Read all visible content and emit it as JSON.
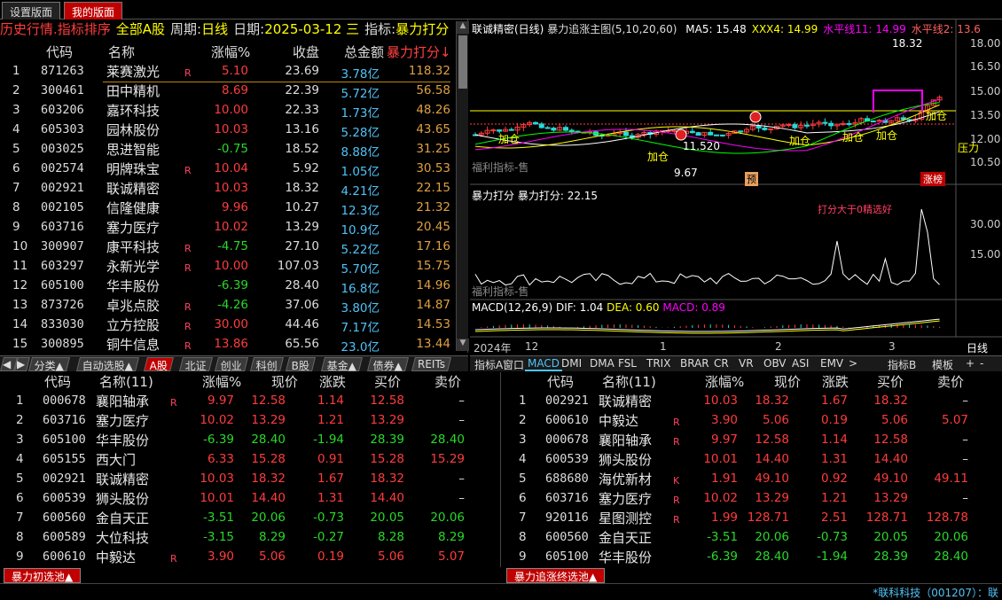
{
  "top_tabs": [
    "设置版面",
    "我的版面"
  ],
  "header": {
    "title": "历史行情.指标排序",
    "market": "全部A股",
    "period_label": "周期:",
    "period": "日线",
    "date_label": "日期:",
    "date": "2025-03-12 三",
    "indicator_label": "指标:",
    "indicator": "暴力打分"
  },
  "list_columns": [
    "代码",
    "名称",
    "涨幅%",
    "收盘",
    "总金额",
    "暴力打分↓"
  ],
  "list_rows": [
    {
      "i": "1",
      "code": "871263",
      "name": "莱赛激光",
      "flag": "R",
      "chg": "5.10",
      "price": "23.69",
      "amt": "3.78亿",
      "score": "118.32",
      "dir": "up"
    },
    {
      "i": "2",
      "code": "300461",
      "name": "田中精机",
      "flag": "",
      "chg": "8.69",
      "price": "22.39",
      "amt": "5.72亿",
      "score": "56.58",
      "dir": "up"
    },
    {
      "i": "3",
      "code": "603206",
      "name": "嘉环科技",
      "flag": "",
      "chg": "10.00",
      "price": "22.33",
      "amt": "1.73亿",
      "score": "48.26",
      "dir": "up"
    },
    {
      "i": "4",
      "code": "605303",
      "name": "园林股份",
      "flag": "",
      "chg": "10.03",
      "price": "13.16",
      "amt": "5.28亿",
      "score": "43.65",
      "dir": "up"
    },
    {
      "i": "5",
      "code": "003025",
      "name": "思进智能",
      "flag": "",
      "chg": "-0.75",
      "price": "18.52",
      "amt": "8.88亿",
      "score": "31.25",
      "dir": "down"
    },
    {
      "i": "6",
      "code": "002574",
      "name": "明牌珠宝",
      "flag": "R",
      "chg": "10.04",
      "price": "5.92",
      "amt": "1.05亿",
      "score": "30.53",
      "dir": "up"
    },
    {
      "i": "7",
      "code": "002921",
      "name": "联诚精密",
      "flag": "",
      "chg": "10.03",
      "price": "18.32",
      "amt": "4.21亿",
      "score": "22.15",
      "dir": "up"
    },
    {
      "i": "8",
      "code": "002105",
      "name": "信隆健康",
      "flag": "",
      "chg": "9.96",
      "price": "10.27",
      "amt": "12.3亿",
      "score": "21.32",
      "dir": "up"
    },
    {
      "i": "9",
      "code": "603716",
      "name": "塞力医疗",
      "flag": "",
      "chg": "10.02",
      "price": "13.29",
      "amt": "10.9亿",
      "score": "20.45",
      "dir": "up"
    },
    {
      "i": "10",
      "code": "300907",
      "name": "康平科技",
      "flag": "R",
      "chg": "-4.75",
      "price": "27.10",
      "amt": "5.22亿",
      "score": "17.16",
      "dir": "down"
    },
    {
      "i": "11",
      "code": "603297",
      "name": "永新光学",
      "flag": "R",
      "chg": "10.00",
      "price": "107.03",
      "amt": "5.70亿",
      "score": "15.75",
      "dir": "up"
    },
    {
      "i": "12",
      "code": "605100",
      "name": "华丰股份",
      "flag": "",
      "chg": "-6.39",
      "price": "28.40",
      "amt": "16.8亿",
      "score": "14.96",
      "dir": "down"
    },
    {
      "i": "13",
      "code": "873726",
      "name": "卓兆点胶",
      "flag": "R",
      "chg": "-4.26",
      "price": "37.06",
      "amt": "3.80亿",
      "score": "14.87",
      "dir": "down"
    },
    {
      "i": "14",
      "code": "833030",
      "name": "立方控股",
      "flag": "R",
      "chg": "30.00",
      "price": "44.46",
      "amt": "7.17亿",
      "score": "14.53",
      "dir": "up"
    },
    {
      "i": "15",
      "code": "300895",
      "name": "铜牛信息",
      "flag": "R",
      "chg": "13.86",
      "price": "65.56",
      "amt": "23.0亿",
      "score": "13.44",
      "dir": "up"
    }
  ],
  "category_tabs": [
    "分类▲",
    "自动选股▲",
    "A股",
    "北证",
    "创业",
    "科创",
    "B股",
    "基金▲",
    "债券▲",
    "REITs"
  ],
  "chart": {
    "main_title": "联诚精密(日线)",
    "main_indicator": "暴力追涨主图(5,10,20,60)",
    "ma_labels": [
      {
        "t": "MA5: 15.48",
        "c": "#ffffff"
      },
      {
        "t": "XXX4: 14.99",
        "c": "#ffff00"
      },
      {
        "t": "水平线11: 14.99",
        "c": "#ff00ff"
      },
      {
        "t": "水平线2: 13.6",
        "c": "#ff6060"
      }
    ],
    "price_ticks": [
      "18.00",
      "16.50",
      "15.00",
      "13.50",
      "12.00",
      "10.50"
    ],
    "price_high_label": "18.32",
    "low_label": "9.67",
    "mid_label": "11.520",
    "annotations": [
      "加仓",
      "加仓",
      "加仓",
      "加仓",
      "加仓",
      "加仓",
      "压力"
    ],
    "watermark": "福利指标-售",
    "pre_label": "预",
    "zt_label": "涨榜",
    "score_title": "暴力打分",
    "score_value_label": "暴力打分: 22.15",
    "score_ticks": [
      "30.00",
      "15.00"
    ],
    "score_top_text": "打分大于0精选好",
    "macd_title": "MACD(12,26,9)",
    "dif": "DIF: 1.04",
    "dea": "DEA: 0.60",
    "macd": "MACD: 0.89",
    "x_labels": [
      "2024年",
      "12",
      "1",
      "2",
      "3"
    ],
    "period_btn": "日线"
  },
  "indicator_tabs": [
    "指标A",
    "窗口",
    "MACD",
    "DMI",
    "DMA",
    "FSL",
    "TRIX",
    "BRAR",
    "CR",
    "VR",
    "OBV",
    "ASI",
    "EMV",
    ">",
    "指标B",
    "模板",
    "+",
    "-"
  ],
  "left_table": {
    "columns": [
      "代码",
      "名称(11)",
      "涨幅%",
      "现价",
      "涨跌",
      "买价",
      "卖价"
    ],
    "rows": [
      {
        "i": "1",
        "code": "000678",
        "name": "襄阳轴承",
        "flag": "R",
        "chg": "9.97",
        "price": "12.58",
        "diff": "1.14",
        "bid": "12.58",
        "ask": "–",
        "dir": "up"
      },
      {
        "i": "2",
        "code": "603716",
        "name": "塞力医疗",
        "flag": "",
        "chg": "10.02",
        "price": "13.29",
        "diff": "1.21",
        "bid": "13.29",
        "ask": "–",
        "dir": "up"
      },
      {
        "i": "3",
        "code": "605100",
        "name": "华丰股份",
        "flag": "",
        "chg": "-6.39",
        "price": "28.40",
        "diff": "-1.94",
        "bid": "28.39",
        "ask": "28.40",
        "dir": "down"
      },
      {
        "i": "4",
        "code": "605155",
        "name": "西大门",
        "flag": "",
        "chg": "6.33",
        "price": "15.28",
        "diff": "0.91",
        "bid": "15.28",
        "ask": "15.29",
        "dir": "up"
      },
      {
        "i": "5",
        "code": "002921",
        "name": "联诚精密",
        "flag": "",
        "chg": "10.03",
        "price": "18.32",
        "diff": "1.67",
        "bid": "18.32",
        "ask": "–",
        "dir": "up"
      },
      {
        "i": "6",
        "code": "600539",
        "name": "狮头股份",
        "flag": "",
        "chg": "10.01",
        "price": "14.40",
        "diff": "1.31",
        "bid": "14.40",
        "ask": "–",
        "dir": "up"
      },
      {
        "i": "7",
        "code": "600560",
        "name": "金自天正",
        "flag": "",
        "chg": "-3.51",
        "price": "20.06",
        "diff": "-0.73",
        "bid": "20.05",
        "ask": "20.06",
        "dir": "down"
      },
      {
        "i": "8",
        "code": "600589",
        "name": "大位科技",
        "flag": "",
        "chg": "-3.15",
        "price": "8.29",
        "diff": "-0.27",
        "bid": "8.28",
        "ask": "8.29",
        "dir": "down"
      },
      {
        "i": "9",
        "code": "600610",
        "name": "中毅达",
        "flag": "R",
        "chg": "3.90",
        "price": "5.06",
        "diff": "0.19",
        "bid": "5.06",
        "ask": "5.07",
        "dir": "up"
      }
    ]
  },
  "right_table": {
    "columns": [
      "代码",
      "名称(11)",
      "涨幅%",
      "现价",
      "涨跌",
      "买价",
      "卖价"
    ],
    "rows": [
      {
        "i": "1",
        "code": "002921",
        "name": "联诚精密",
        "flag": "",
        "chg": "10.03",
        "price": "18.32",
        "diff": "1.67",
        "bid": "18.32",
        "ask": "–",
        "dir": "up"
      },
      {
        "i": "2",
        "code": "600610",
        "name": "中毅达",
        "flag": "R",
        "chg": "3.90",
        "price": "5.06",
        "diff": "0.19",
        "bid": "5.06",
        "ask": "5.07",
        "dir": "up"
      },
      {
        "i": "3",
        "code": "000678",
        "name": "襄阳轴承",
        "flag": "R",
        "chg": "9.97",
        "price": "12.58",
        "diff": "1.14",
        "bid": "12.58",
        "ask": "–",
        "dir": "up"
      },
      {
        "i": "4",
        "code": "600539",
        "name": "狮头股份",
        "flag": "",
        "chg": "10.01",
        "price": "14.40",
        "diff": "1.31",
        "bid": "14.40",
        "ask": "–",
        "dir": "up"
      },
      {
        "i": "5",
        "code": "688680",
        "name": "海优新材",
        "flag": "K",
        "chg": "1.91",
        "price": "49.10",
        "diff": "0.92",
        "bid": "49.10",
        "ask": "49.11",
        "dir": "up"
      },
      {
        "i": "6",
        "code": "603716",
        "name": "塞力医疗",
        "flag": "R",
        "chg": "10.02",
        "price": "13.29",
        "diff": "1.21",
        "bid": "13.29",
        "ask": "–",
        "dir": "up"
      },
      {
        "i": "7",
        "code": "920116",
        "name": "星图测控",
        "flag": "R",
        "chg": "1.99",
        "price": "128.71",
        "diff": "2.51",
        "bid": "128.71",
        "ask": "128.78",
        "dir": "up"
      },
      {
        "i": "8",
        "code": "600560",
        "name": "金自天正",
        "flag": "",
        "chg": "-3.51",
        "price": "20.06",
        "diff": "-0.73",
        "bid": "20.05",
        "ask": "20.06",
        "dir": "down"
      },
      {
        "i": "9",
        "code": "605100",
        "name": "华丰股份",
        "flag": "",
        "chg": "-6.39",
        "price": "28.40",
        "diff": "-1.94",
        "bid": "28.39",
        "ask": "28.40",
        "dir": "down"
      }
    ]
  },
  "pool_buttons": [
    "暴力初选池▲",
    "暴力追涨终选池▲"
  ],
  "status_text": "*联科科技（001207）：联"
}
